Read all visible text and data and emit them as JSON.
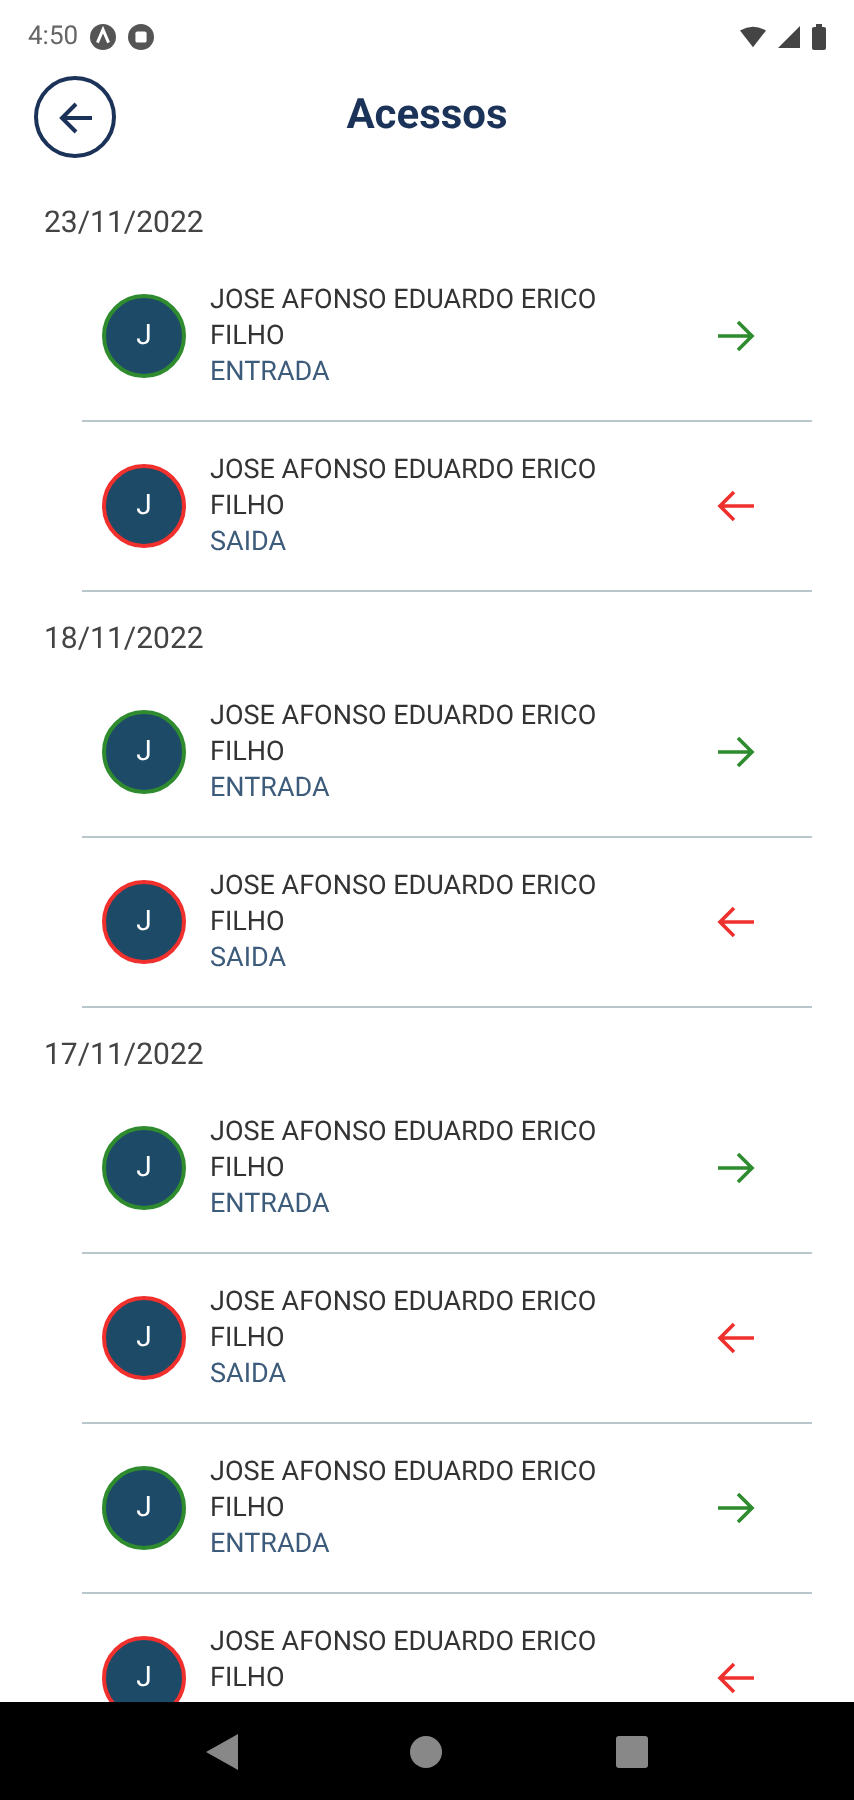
{
  "status_bar": {
    "time": "4:50"
  },
  "header": {
    "title": "Acessos"
  },
  "groups": [
    {
      "date": "23/11/2022",
      "entries": [
        {
          "initial": "J",
          "name": "JOSE AFONSO EDUARDO ERICO FILHO",
          "kind": "entrada",
          "label": "ENTRADA"
        },
        {
          "initial": "J",
          "name": "JOSE AFONSO EDUARDO ERICO FILHO",
          "kind": "saida",
          "label": "SAIDA"
        }
      ]
    },
    {
      "date": "18/11/2022",
      "entries": [
        {
          "initial": "J",
          "name": "JOSE AFONSO EDUARDO ERICO FILHO",
          "kind": "entrada",
          "label": "ENTRADA"
        },
        {
          "initial": "J",
          "name": "JOSE AFONSO EDUARDO ERICO FILHO",
          "kind": "saida",
          "label": "SAIDA"
        }
      ]
    },
    {
      "date": "17/11/2022",
      "entries": [
        {
          "initial": "J",
          "name": "JOSE AFONSO EDUARDO ERICO FILHO",
          "kind": "entrada",
          "label": "ENTRADA"
        },
        {
          "initial": "J",
          "name": "JOSE AFONSO EDUARDO ERICO FILHO",
          "kind": "saida",
          "label": "SAIDA"
        },
        {
          "initial": "J",
          "name": "JOSE AFONSO EDUARDO ERICO FILHO",
          "kind": "entrada",
          "label": "ENTRADA"
        },
        {
          "initial": "J",
          "name": "JOSE AFONSO EDUARDO ERICO FILHO",
          "kind": "saida"
        }
      ]
    }
  ]
}
